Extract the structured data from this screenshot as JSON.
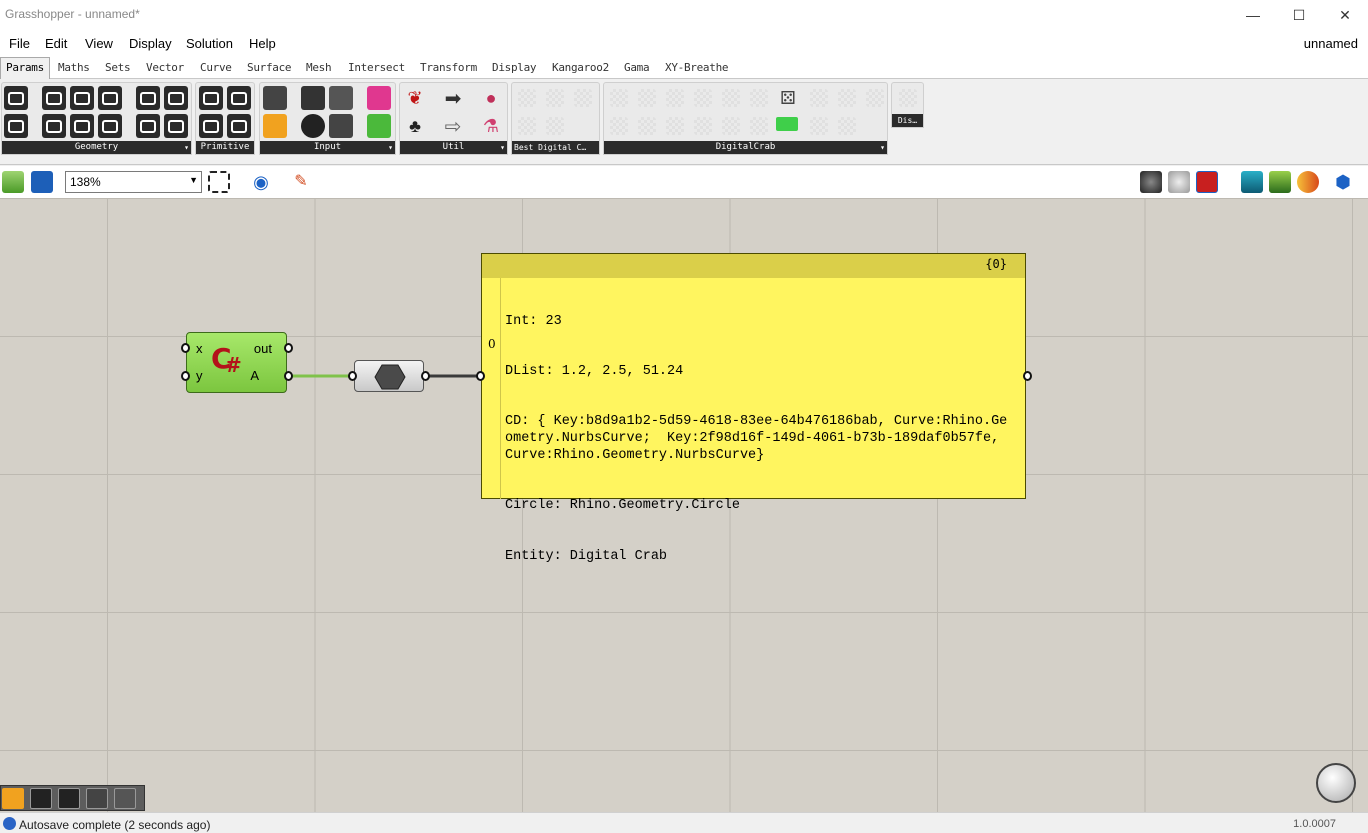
{
  "window": {
    "title": "Grasshopper - unnamed*",
    "controls": {
      "minimize": "—",
      "maximize": "☐",
      "close": "✕"
    }
  },
  "menu": {
    "items": [
      "File",
      "Edit",
      "View",
      "Display",
      "Solution",
      "Help"
    ],
    "document_name": "unnamed"
  },
  "tabs": [
    "Params",
    "Maths",
    "Sets",
    "Vector",
    "Curve",
    "Surface",
    "Mesh",
    "Intersect",
    "Transform",
    "Display",
    "Kangaroo2",
    "Gama",
    "XY-Breathe"
  ],
  "active_tab": "Params",
  "ribbon": {
    "panels": [
      "Geometry",
      "Primitive",
      "Input",
      "Util",
      "Best Digital C…",
      "DigitalCrab",
      "Dis…"
    ]
  },
  "canvas_toolbar": {
    "zoom": "138%"
  },
  "canvas": {
    "csharp": {
      "inputs": [
        "x",
        "y"
      ],
      "outputs": [
        "out",
        "A"
      ],
      "logo": "C",
      "logo_sub": "#"
    },
    "panel": {
      "path": "{0}",
      "index": "0",
      "lines": [
        "Int: 23",
        "DList: 1.2, 2.5, 51.24",
        "CD: { Key:b8d9a1b2-5d59-4618-83ee-64b476186bab, Curve:Rhino.Geometry.NurbsCurve;  Key:2f98d16f-149d-4061-b73b-189daf0b57fe, Curve:Rhino.Geometry.NurbsCurve}",
        "Circle: Rhino.Geometry.Circle",
        "Entity: Digital Crab"
      ]
    }
  },
  "status": {
    "message": "Autosave complete (2 seconds ago)",
    "version": "1.0.0007"
  },
  "colors": {
    "canvas_bg": "#d4d0c8",
    "panel_yellow": "#fff55f",
    "component_green": "#8fd453",
    "wire_green": "#7fc24a"
  }
}
